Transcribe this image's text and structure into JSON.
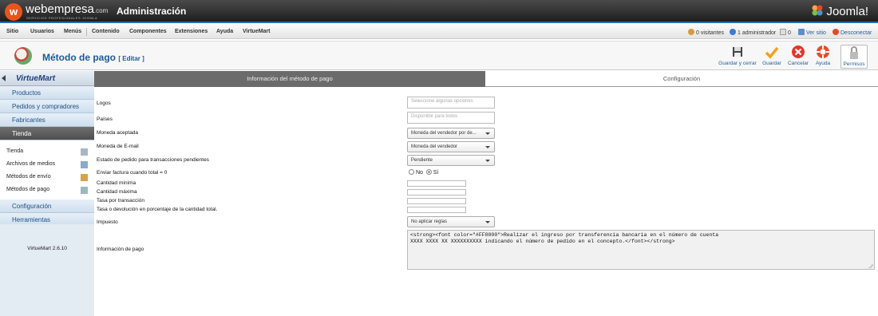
{
  "header": {
    "brand": "webempresa",
    "brand_suffix": ".com",
    "brand_tagline": "SERVICIOS PROFESIONALES JOOMLA",
    "admin_title": "Administración",
    "cms_name": "Joomla!"
  },
  "menu": {
    "items": [
      "Sitio",
      "Usuarios",
      "Menús",
      "Contenido",
      "Componentes",
      "Extensiones",
      "Ayuda",
      "VirtueMart"
    ],
    "status": {
      "visitors": "0 visitantes",
      "admins": "1 administrador",
      "messages": "0",
      "view_site": "Ver sitio",
      "logout": "Desconectar"
    }
  },
  "toolbar": {
    "title": "Método de pago",
    "edit_label": "[ Editar ]",
    "buttons": {
      "save_close": "Guardar y cerrar",
      "save": "Guardar",
      "cancel": "Cancelar",
      "help": "Ayuda",
      "permissions": "Permisos"
    }
  },
  "sidebar": {
    "logo": "VirtueMart",
    "sections": [
      "Productos",
      "Pedidos y compradores",
      "Fabricantes",
      "Tienda"
    ],
    "sub_items": [
      "Tienda",
      "Archivos de medios",
      "Métodos de envío",
      "Métodos de pago"
    ],
    "sections_after": [
      "Configuración",
      "Herramientas"
    ],
    "version": "VirtueMart 2.6.10"
  },
  "tabs": {
    "info": "Información del método de pago",
    "config": "Configuración"
  },
  "form": {
    "labels": {
      "logos": "Logos",
      "countries": "Países",
      "currency": "Moneda aceptada",
      "email_currency": "Moneda de E-mail",
      "order_status": "Estado de pedido para transacciones pendientes",
      "invoice": "Enviar factura cuando total = 0",
      "min": "Cantidad mínima",
      "max": "Cantidad máxima",
      "fee": "Tasa por transacción",
      "fee_pct": "Tasa o devolución en porcentaje de la cantidad total.",
      "tax": "Impuesto",
      "payment_info": "Información de pago"
    },
    "placeholders": {
      "logos": "Seleccione algunas opciones",
      "countries": "Disponible para todos"
    },
    "values": {
      "currency": "Moneda del vendedor por de...",
      "email_currency": "Moneda del vendedor",
      "order_status": "Pendiente",
      "tax": "No aplicar reglas",
      "radio_no": "No",
      "radio_yes": "Sí",
      "payment_info": "<strong><font color=\"#FF0000\">Realizar el ingreso por transferencia bancaria en el número de cuenta\nXXXX XXXX XX XXXXXXXXXX indicando el número de pedido en el concepto.</font></strong>"
    }
  },
  "colors": {
    "accent": "#1f5d96",
    "topbar": "#2b2b2b",
    "active_tab": "#6b6b6b"
  }
}
